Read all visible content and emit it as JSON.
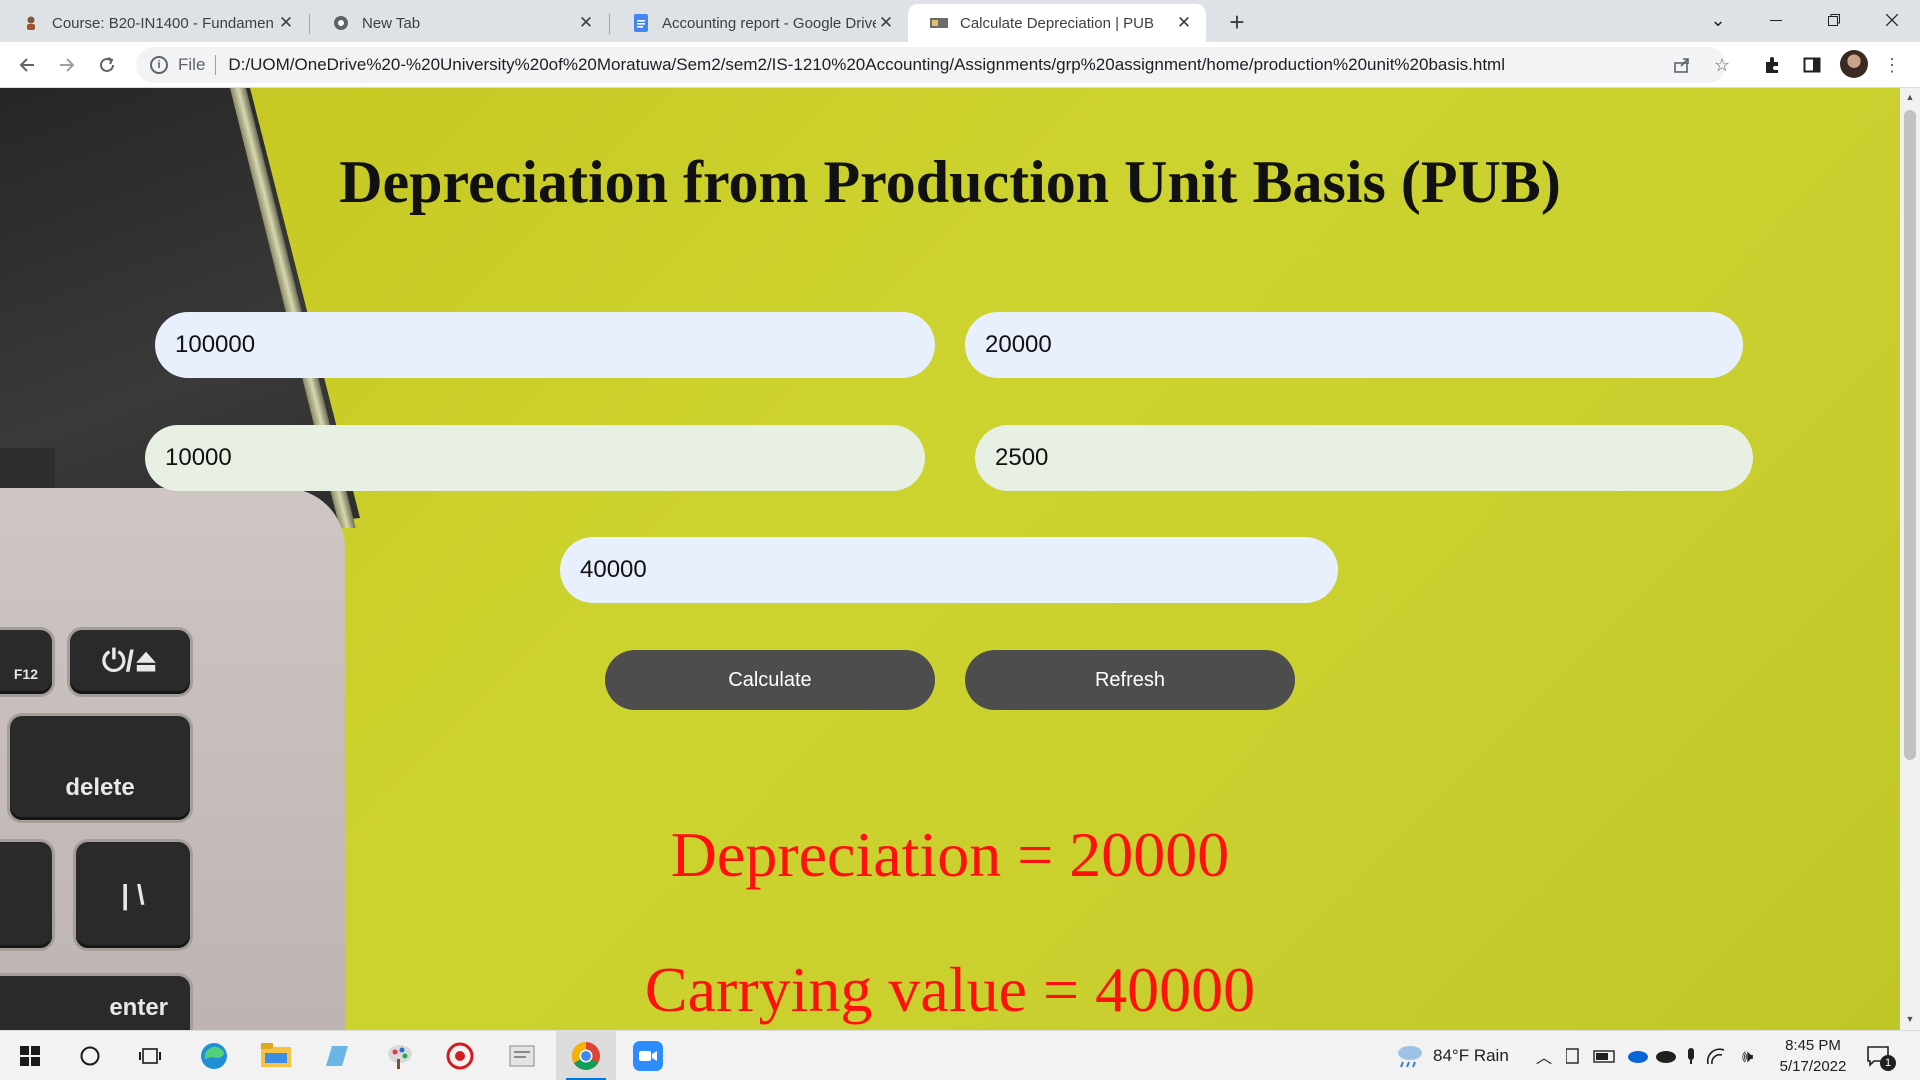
{
  "browser": {
    "tabs": [
      {
        "title": "Course: B20-IN1400 - Fundamen",
        "icon": "moodle-icon",
        "active": false
      },
      {
        "title": "New Tab",
        "icon": "chrome-icon",
        "active": false
      },
      {
        "title": "Accounting report - Google Drive",
        "icon": "google-docs-icon",
        "active": false
      },
      {
        "title": "Calculate Depreciation | PUB",
        "icon": "site-favicon",
        "active": true
      }
    ],
    "url_scheme": "File",
    "url": "D:/UOM/OneDrive%20-%20University%20of%20Moratuwa/Sem2/sem2/IS-1210%20Accounting/Assignments/grp%20assignment/home/production%20unit%20basis.html"
  },
  "page": {
    "heading": "Depreciation from Production Unit Basis (PUB)",
    "inputs": {
      "field1": "100000",
      "field2": "20000",
      "field3": "10000",
      "field4": "2500",
      "field5": "40000"
    },
    "buttons": {
      "calculate": "Calculate",
      "refresh": "Refresh"
    },
    "results": {
      "depreciation": "Depreciation = 20000",
      "carrying_value": "Carrying value = 40000"
    },
    "keyboard": {
      "f12": "F12",
      "power": "⏻/⏏",
      "delete": "delete",
      "backslash": "| \\",
      "enter": "enter"
    }
  },
  "taskbar": {
    "weather": "84°F  Rain",
    "time": "8:45 PM",
    "date": "5/17/2022",
    "notification_count": "1"
  }
}
